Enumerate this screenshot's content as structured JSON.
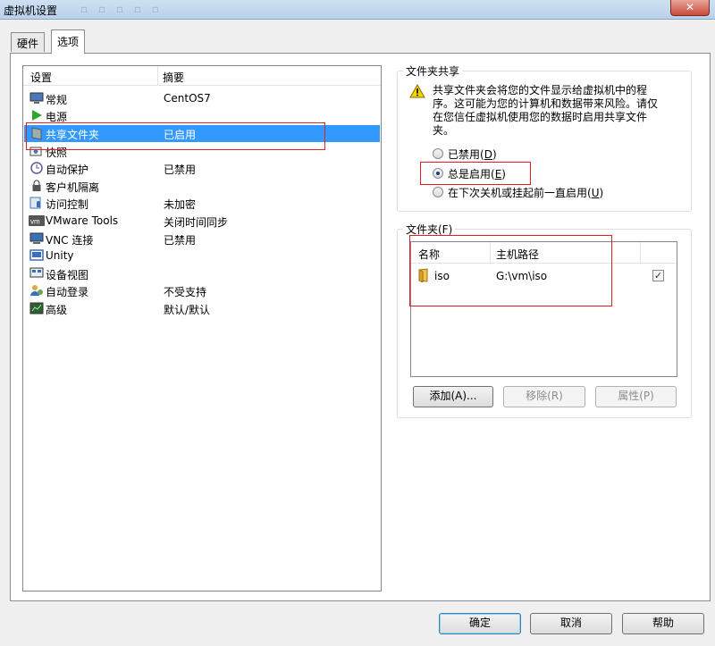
{
  "window": {
    "title": "虚拟机设置",
    "ghost_text": "▫ ▫ ▫ ▫ ▫",
    "close_glyph": "✕"
  },
  "tabs": [
    {
      "label": "硬件",
      "active": false
    },
    {
      "label": "选项",
      "active": true
    }
  ],
  "settings_list": {
    "col_setting": "设置",
    "col_summary": "摘要",
    "items": [
      {
        "label": "常规",
        "summary": "CentOS7",
        "icon": "monitor-icon"
      },
      {
        "label": "电源",
        "summary": "",
        "icon": "play-icon"
      },
      {
        "label": "共享文件夹",
        "summary": "已启用",
        "icon": "shared-folder-icon",
        "selected": true
      },
      {
        "label": "快照",
        "summary": "",
        "icon": "snapshot-icon"
      },
      {
        "label": "自动保护",
        "summary": "已禁用",
        "icon": "autoprotect-icon"
      },
      {
        "label": "客户机隔离",
        "summary": "",
        "icon": "lock-icon"
      },
      {
        "label": "访问控制",
        "summary": "未加密",
        "icon": "access-control-icon"
      },
      {
        "label": "VMware Tools",
        "summary": "关闭时间同步",
        "icon": "vmware-tools-icon"
      },
      {
        "label": "VNC 连接",
        "summary": "已禁用",
        "icon": "vnc-icon"
      },
      {
        "label": "Unity",
        "summary": "",
        "icon": "unity-icon"
      },
      {
        "label": "设备视图",
        "summary": "",
        "icon": "device-view-icon"
      },
      {
        "label": "自动登录",
        "summary": "不受支持",
        "icon": "auto-login-icon"
      },
      {
        "label": "高级",
        "summary": "默认/默认",
        "icon": "advanced-icon"
      }
    ]
  },
  "folder_sharing": {
    "title": "文件夹共享",
    "warning": "共享文件夹会将您的文件显示给虚拟机中的程序。这可能为您的计算机和数据带来风险。请仅在您信任虚拟机使用您的数据时启用共享文件夹。",
    "options": [
      {
        "text": "已禁用(",
        "key": "D",
        "suffix": ")",
        "checked": false
      },
      {
        "text": "总是启用(",
        "key": "E",
        "suffix": ")",
        "checked": true
      },
      {
        "text": "在下次关机或挂起前一直启用(",
        "key": "U",
        "suffix": ")",
        "checked": false
      }
    ]
  },
  "folders": {
    "title": "文件夹(F)",
    "col_name": "名称",
    "col_path": "主机路径",
    "rows": [
      {
        "name": "iso",
        "path": "G:\\vm\\iso",
        "enabled": true
      }
    ],
    "check_glyph": "✓",
    "add_button": "添加(A)...",
    "remove_button": "移除(R)",
    "properties_button": "属性(P)"
  },
  "footer": {
    "ok": "确定",
    "cancel": "取消",
    "help": "帮助"
  },
  "colors": {
    "selection": "#3399ff",
    "highlight_box": "#e02020"
  }
}
